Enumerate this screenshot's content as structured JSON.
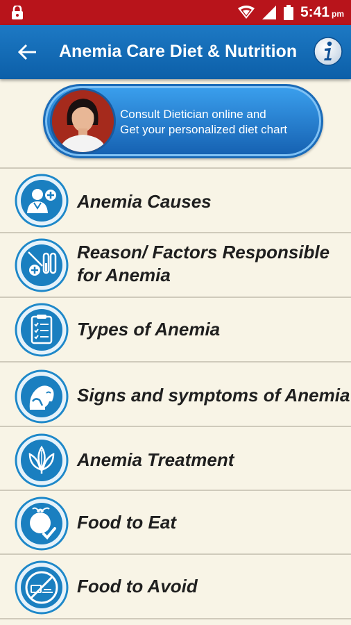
{
  "status_bar": {
    "time": "5:41",
    "ampm": "pm",
    "icons": [
      "lock-icon",
      "wifi-icon",
      "signal-icon",
      "battery-icon"
    ]
  },
  "app_bar": {
    "title": "Anemia Care Diet & Nutrition",
    "back_icon": "arrow-left-icon",
    "info_icon": "info-icon"
  },
  "consult_banner": {
    "line1": "Consult Dietician online and",
    "line2": "Get your personalized diet chart"
  },
  "menu": {
    "items": [
      {
        "label": "Anemia Causes",
        "icon": "doctor-plus-icon"
      },
      {
        "label_line1": "Reason/ Factors Responsible",
        "label_line2": "for Anemia",
        "icon": "test-tubes-icon"
      },
      {
        "label": "Types of Anemia",
        "icon": "clipboard-checklist-icon"
      },
      {
        "label": "Signs and symptoms of Anemia",
        "icon": "person-symptoms-icon"
      },
      {
        "label": "Anemia Treatment",
        "icon": "leaves-icon"
      },
      {
        "label": "Food to Eat",
        "icon": "beetroot-check-icon"
      },
      {
        "label": "Food to Avoid",
        "icon": "no-food-icon"
      }
    ]
  },
  "colors": {
    "status_bar": "#b8141b",
    "app_bar": "#1269b5",
    "background": "#f8f4e6",
    "icon_ring": "#1e88c9"
  }
}
